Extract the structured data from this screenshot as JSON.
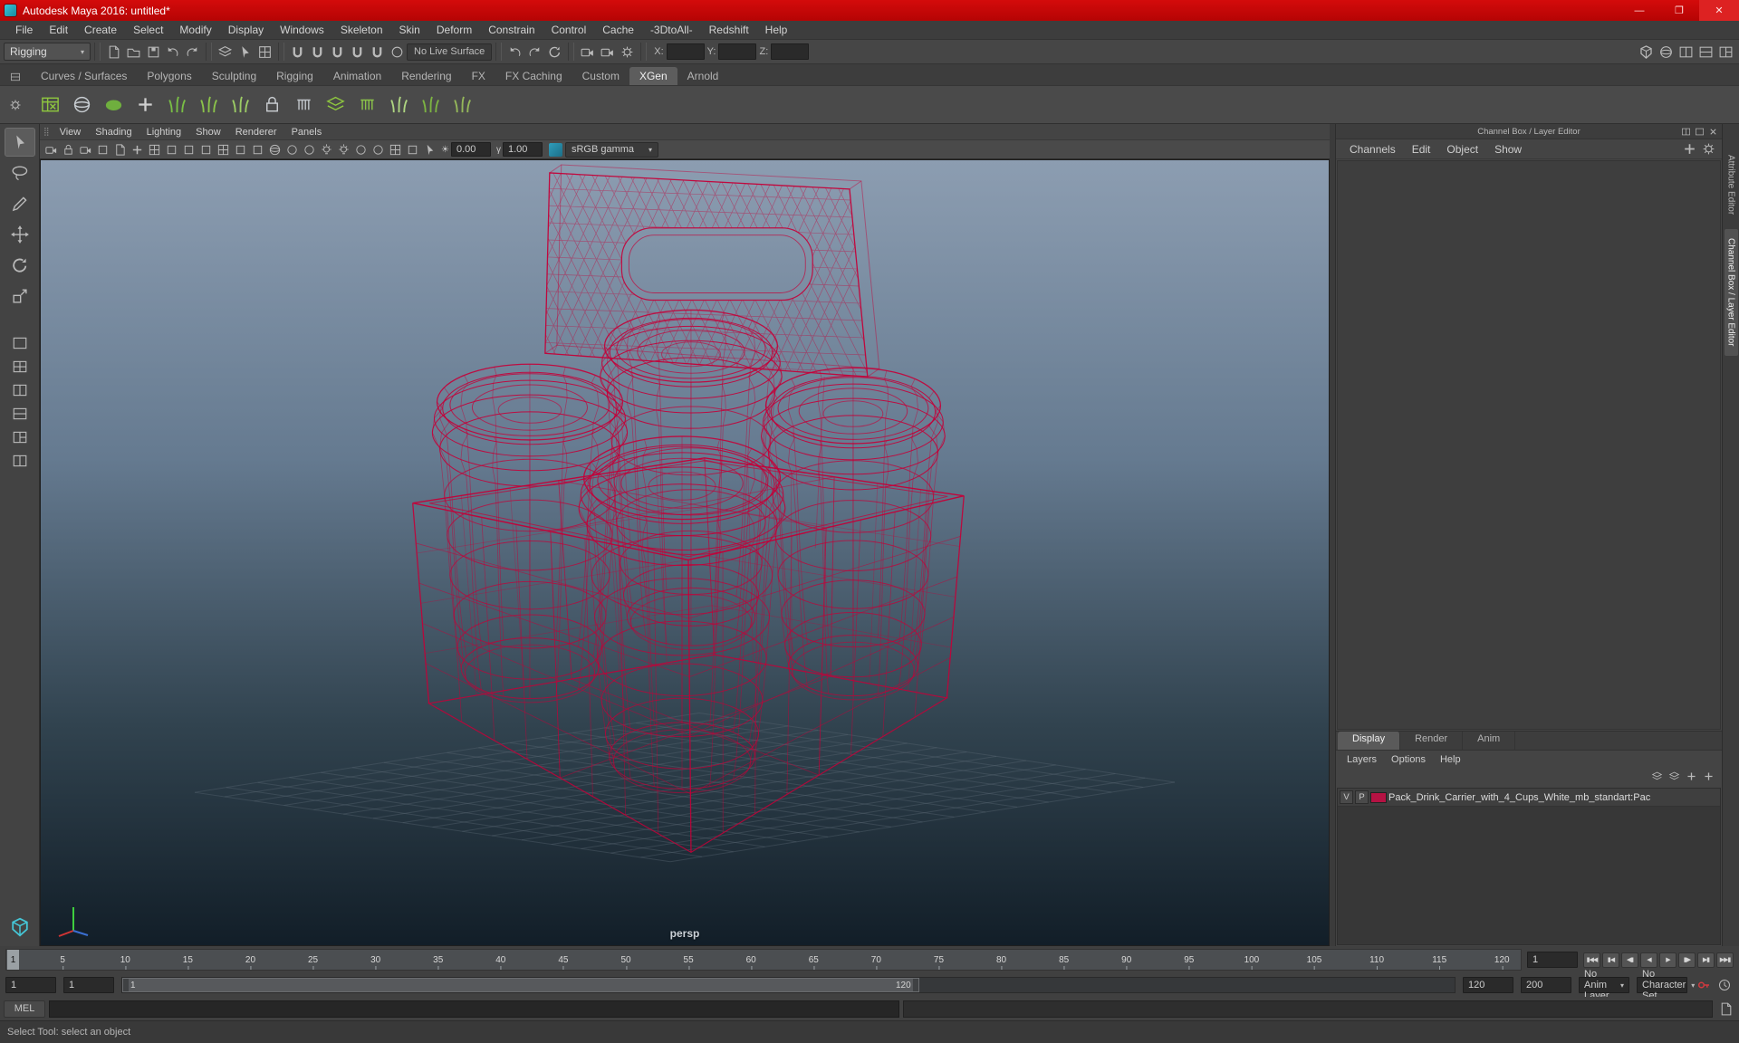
{
  "colors": {
    "wire": "#c40038",
    "grid": "#5a6874",
    "titlebar": "#c00000",
    "layer_swatch": "#b51243"
  },
  "titlebar": {
    "title": "Autodesk Maya 2016: untitled*",
    "minimize": "—",
    "maximize": "❐",
    "close": "✕"
  },
  "menubar": {
    "items": [
      "File",
      "Edit",
      "Create",
      "Select",
      "Modify",
      "Display",
      "Windows",
      "Skeleton",
      "Skin",
      "Deform",
      "Constrain",
      "Control",
      "Cache",
      "-3DtoAll-",
      "Redshift",
      "Help"
    ]
  },
  "statusline": {
    "menuset": "Rigging",
    "file_icons": [
      {
        "name": "new-scene-icon",
        "kind": "doc"
      },
      {
        "name": "open-scene-icon",
        "kind": "folder"
      },
      {
        "name": "save-scene-icon",
        "kind": "disk"
      }
    ],
    "undo_icons": [
      {
        "name": "undo-icon",
        "kind": "undo"
      },
      {
        "name": "redo-icon",
        "kind": "redo"
      }
    ],
    "mode_icons": [
      {
        "name": "select-hierarchy-icon",
        "kind": "layers"
      },
      {
        "name": "select-object-icon",
        "kind": "cursor"
      },
      {
        "name": "select-component-icon",
        "kind": "grid"
      }
    ],
    "snap_icons": [
      {
        "name": "snap-to-grid-icon",
        "kind": "magnet"
      },
      {
        "name": "snap-to-curve-icon",
        "kind": "magnet"
      },
      {
        "name": "snap-to-point-icon",
        "kind": "magnet"
      },
      {
        "name": "snap-to-projected-center-icon",
        "kind": "magnet"
      },
      {
        "name": "snap-to-view-plane-icon",
        "kind": "magnet"
      },
      {
        "name": "make-live-icon",
        "kind": "circle"
      }
    ],
    "live_surface": "No Live Surface",
    "history_icons": [
      {
        "name": "input-connections-icon",
        "kind": "undo"
      },
      {
        "name": "output-connections-icon",
        "kind": "redo"
      },
      {
        "name": "construction-history-icon",
        "kind": "rotate"
      }
    ],
    "render_icons": [
      {
        "name": "render-current-frame-icon",
        "kind": "cam"
      },
      {
        "name": "ipr-render-icon",
        "kind": "cam"
      },
      {
        "name": "render-settings-icon",
        "kind": "gear"
      }
    ],
    "coord_labels": {
      "x": "X:",
      "y": "Y:",
      "z": "Z:"
    },
    "sidebar_icons": [
      {
        "name": "modeling-toolkit-toggle-icon",
        "kind": "cube"
      },
      {
        "name": "hypershade-toggle-icon",
        "kind": "sphere"
      },
      {
        "name": "attribute-editor-toggle-icon",
        "kind": "pane2v"
      },
      {
        "name": "tool-settings-toggle-icon",
        "kind": "pane2h"
      },
      {
        "name": "channel-box-toggle-icon",
        "kind": "pane3"
      }
    ]
  },
  "shelf": {
    "tabs": [
      {
        "label": "Curves / Surfaces",
        "name": "shelf-tab-curves-surfaces"
      },
      {
        "label": "Polygons",
        "name": "shelf-tab-polygons"
      },
      {
        "label": "Sculpting",
        "name": "shelf-tab-sculpting"
      },
      {
        "label": "Rigging",
        "name": "shelf-tab-rigging"
      },
      {
        "label": "Animation",
        "name": "shelf-tab-animation"
      },
      {
        "label": "Rendering",
        "name": "shelf-tab-rendering"
      },
      {
        "label": "FX",
        "name": "shelf-tab-fx"
      },
      {
        "label": "FX Caching",
        "name": "shelf-tab-fx-caching"
      },
      {
        "label": "Custom",
        "name": "shelf-tab-custom"
      },
      {
        "label": "XGen",
        "name": "shelf-tab-xgen",
        "active": true
      },
      {
        "label": "Arnold",
        "name": "shelf-tab-arnold"
      }
    ],
    "icons": [
      {
        "name": "xgen-editor-icon",
        "kind": "xsheet",
        "color": "#8ec63f"
      },
      {
        "name": "xgen-create-description-icon",
        "kind": "sphere",
        "color": "#c8cdd2"
      },
      {
        "name": "xgen-create-collection-icon",
        "kind": "blob",
        "color": "#6faf3e"
      },
      {
        "name": "xgen-add-guide-icon",
        "kind": "plus",
        "color": "#d0d0d0"
      },
      {
        "name": "xgen-guide-icon",
        "kind": "grass",
        "color": "#79be45"
      },
      {
        "name": "xgen-density-brush-icon",
        "kind": "grass",
        "color": "#8bc34a"
      },
      {
        "name": "xgen-length-brush-icon",
        "kind": "grass",
        "color": "#9ccc65"
      },
      {
        "name": "xgen-lock-icon",
        "kind": "lock",
        "color": "#c9cdd1"
      },
      {
        "name": "xgen-groom-icon",
        "kind": "comb",
        "color": "#bfc4c9"
      },
      {
        "name": "xgen-layers-icon",
        "kind": "layers",
        "color": "#8ec63f"
      },
      {
        "name": "xgen-comb-brush-icon",
        "kind": "comb",
        "color": "#8bc34a"
      },
      {
        "name": "xgen-smooth-brush-icon",
        "kind": "grass",
        "color": "#aed581"
      },
      {
        "name": "xgen-noise-brush-icon",
        "kind": "grass",
        "color": "#7cb342"
      },
      {
        "name": "xgen-clump-brush-icon",
        "kind": "grass",
        "color": "#95b85a"
      }
    ]
  },
  "toolbox": {
    "tools": [
      {
        "name": "select-tool-icon",
        "kind": "cursor",
        "active": true
      },
      {
        "name": "lasso-tool-icon",
        "kind": "lasso"
      },
      {
        "name": "paint-select-tool-icon",
        "kind": "brush"
      },
      {
        "name": "move-tool-icon",
        "kind": "movearrows"
      },
      {
        "name": "rotate-tool-icon",
        "kind": "rotate"
      },
      {
        "name": "scale-tool-icon",
        "kind": "scale"
      }
    ],
    "layouts": [
      {
        "name": "layout-single-pane-icon",
        "kind": "pane1"
      },
      {
        "name": "layout-four-pane-icon",
        "kind": "pane4"
      },
      {
        "name": "layout-two-pane-side-icon",
        "kind": "pane2v"
      },
      {
        "name": "layout-two-pane-stacked-icon",
        "kind": "pane2h"
      },
      {
        "name": "layout-three-pane-icon",
        "kind": "pane3"
      },
      {
        "name": "layout-outliner-persp-icon",
        "kind": "pane2v"
      }
    ],
    "bottom_icon": [
      {
        "name": "modeling-toolkit-icon",
        "kind": "cube",
        "color": "#45c6d6"
      }
    ]
  },
  "viewport": {
    "menus": [
      "View",
      "Shading",
      "Lighting",
      "Show",
      "Renderer",
      "Panels"
    ],
    "toolbar_icons": [
      {
        "name": "select-camera-icon",
        "kind": "cam"
      },
      {
        "name": "lock-camera-icon",
        "kind": "lock"
      },
      {
        "name": "camera-attributes-icon",
        "kind": "cam"
      },
      {
        "name": "bookmarks-icon",
        "kind": "square"
      },
      {
        "name": "image-plane-icon",
        "kind": "doc"
      },
      {
        "name": "two-d-pan-zoom-icon",
        "kind": "plus"
      },
      {
        "name": "grid-toggle-icon",
        "kind": "grid"
      },
      {
        "name": "film-gate-icon",
        "kind": "square"
      },
      {
        "name": "resolution-gate-icon",
        "kind": "square"
      },
      {
        "name": "gate-mask-icon",
        "kind": "square"
      },
      {
        "name": "field-chart-icon",
        "kind": "grid"
      },
      {
        "name": "safe-action-icon",
        "kind": "square"
      },
      {
        "name": "safe-title-icon",
        "kind": "square"
      },
      {
        "name": "wireframe-display-icon",
        "kind": "sphere"
      },
      {
        "name": "shaded-display-icon",
        "kind": "circle"
      },
      {
        "name": "textured-display-icon",
        "kind": "circle"
      },
      {
        "name": "use-all-lights-icon",
        "kind": "light"
      },
      {
        "name": "shadows-icon",
        "kind": "light"
      },
      {
        "name": "ambient-occlusion-icon",
        "kind": "circle"
      },
      {
        "name": "motion-blur-icon",
        "kind": "circle"
      },
      {
        "name": "multisample-icon",
        "kind": "grid"
      },
      {
        "name": "xray-icon",
        "kind": "square"
      },
      {
        "name": "isolate-select-icon",
        "kind": "cursor"
      }
    ],
    "exposure_symbol": "☀",
    "exposure": "0.00",
    "gamma_symbol": "γ",
    "gamma": "1.00",
    "colorspace": "sRGB gamma",
    "camera": "persp"
  },
  "channel_box": {
    "title": "Channel Box / Layer Editor",
    "header_icons": [
      {
        "name": "dock-panel-icon",
        "kind": "pane2v"
      },
      {
        "name": "float-panel-icon",
        "kind": "pane1"
      },
      {
        "name": "close-panel-icon",
        "kind": "x"
      }
    ],
    "menus": [
      "Channels",
      "Edit",
      "Object",
      "Show"
    ],
    "menu_icons": [
      {
        "name": "show-manipulators-icon",
        "kind": "plus"
      },
      {
        "name": "channel-settings-icon",
        "kind": "gear"
      }
    ]
  },
  "layer_editor": {
    "tabs": [
      {
        "label": "Display",
        "name": "layer-tab-display",
        "active": true
      },
      {
        "label": "Render",
        "name": "layer-tab-render"
      },
      {
        "label": "Anim",
        "name": "layer-tab-anim"
      }
    ],
    "menus": [
      "Layers",
      "Options",
      "Help"
    ],
    "toolbar_icons": [
      {
        "name": "layer-toolbar-icon-1",
        "kind": "layers"
      },
      {
        "name": "layer-toolbar-icon-2",
        "kind": "layers"
      },
      {
        "name": "layer-toolbar-icon-3",
        "kind": "plus"
      },
      {
        "name": "layer-toolbar-icon-4",
        "kind": "plus"
      }
    ],
    "layer": {
      "visibility": "V",
      "playback": "P",
      "name": "Pack_Drink_Carrier_with_4_Cups_White_mb_standart:Pac"
    }
  },
  "right_strip": {
    "tabs": [
      {
        "label": "Attribute Editor",
        "name": "vtab-attribute-editor"
      },
      {
        "label": "Channel Box / Layer Editor",
        "name": "vtab-channel-box",
        "active": true
      }
    ]
  },
  "timeline": {
    "labels": [
      5,
      10,
      15,
      20,
      25,
      30,
      35,
      40,
      45,
      50,
      55,
      60,
      65,
      70,
      75,
      80,
      85,
      90,
      95,
      100,
      105,
      110,
      115,
      120
    ],
    "current": "1",
    "frame_field": "1",
    "transport": [
      {
        "name": "go-to-start-button",
        "kind": "tglyph"
      },
      {
        "name": "step-back-frame-button",
        "kind": "tglyph"
      },
      {
        "name": "step-back-key-button",
        "kind": "tglyph"
      },
      {
        "name": "play-backwards-button",
        "kind": "tglyph"
      },
      {
        "name": "play-forwards-button",
        "kind": "tglyph"
      },
      {
        "name": "step-forward-key-button",
        "kind": "tglyph"
      },
      {
        "name": "step-forward-frame-button",
        "kind": "tglyph"
      },
      {
        "name": "go-to-end-button",
        "kind": "tglyph"
      }
    ]
  },
  "range": {
    "anim_start": "1",
    "play_start": "1",
    "bar_start_label": "1",
    "bar_end_label": "120",
    "play_end": "120",
    "anim_end": "200",
    "anim_layer": "No Anim Layer",
    "character_set": "No Character Set",
    "icons": [
      {
        "name": "auto-keyframe-icon",
        "kind": "key",
        "color": "#d2393f"
      },
      {
        "name": "animation-preferences-icon",
        "kind": "clock"
      }
    ]
  },
  "command_line": {
    "label": "MEL",
    "input_value": "",
    "output_value": ""
  },
  "help_line": {
    "text": "Select Tool: select an object"
  }
}
